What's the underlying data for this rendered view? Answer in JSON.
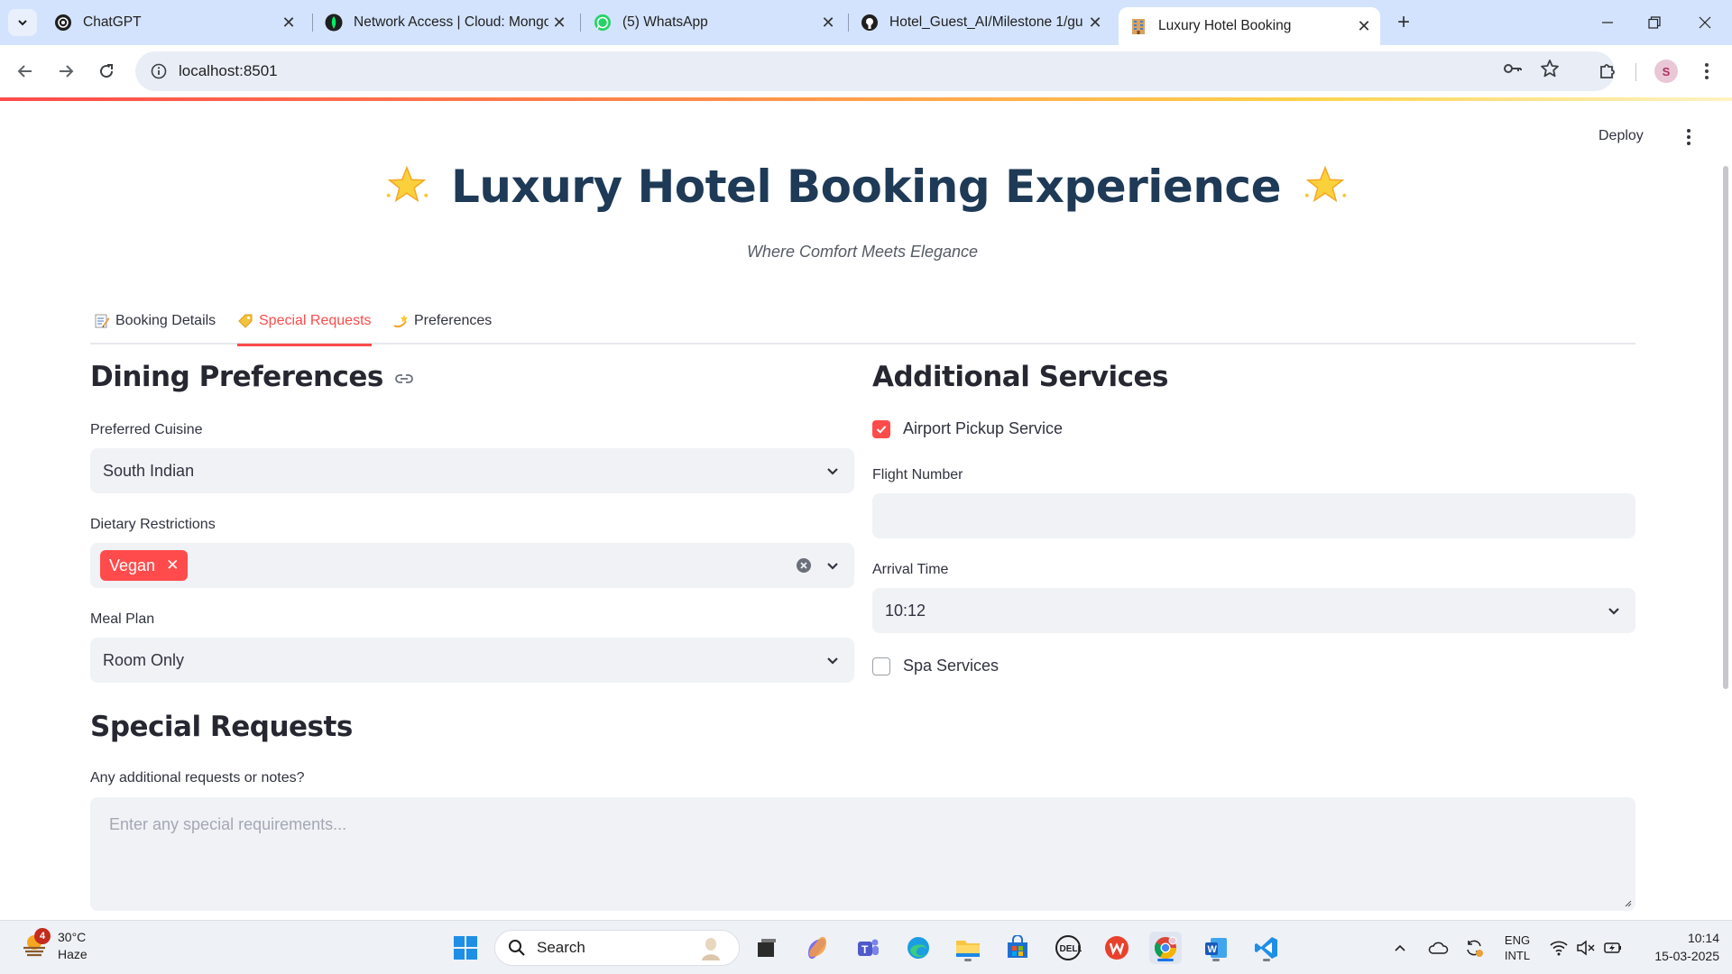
{
  "browser": {
    "tabs": [
      {
        "title": "ChatGPT",
        "icon": "chatgpt-icon",
        "active": false
      },
      {
        "title": "Network Access | Cloud: Mongo",
        "icon": "mongodb-leaf-icon",
        "active": false
      },
      {
        "title": "(5) WhatsApp",
        "icon": "whatsapp-icon",
        "active": false
      },
      {
        "title": "Hotel_Guest_AI/Milestone 1/gu",
        "icon": "github-icon",
        "active": false
      },
      {
        "title": "Luxury Hotel Booking",
        "icon": "hotel-building-icon",
        "active": true
      }
    ],
    "url": "localhost:8501"
  },
  "app": {
    "deploy_label": "Deploy",
    "title": "Luxury Hotel Booking Experience",
    "subtitle": "Where Comfort Meets Elegance",
    "tabs": [
      {
        "label": "Booking Details",
        "icon": "memo-icon",
        "active": false
      },
      {
        "label": "Special Requests",
        "icon": "label-tag-icon",
        "active": true
      },
      {
        "label": "Preferences",
        "icon": "dizzy-star-icon",
        "active": false
      }
    ],
    "dining": {
      "heading": "Dining Preferences",
      "cuisine_label": "Preferred Cuisine",
      "cuisine_value": "South Indian",
      "dietary_label": "Dietary Restrictions",
      "dietary_selected": [
        "Vegan"
      ],
      "meal_label": "Meal Plan",
      "meal_value": "Room Only"
    },
    "services": {
      "heading": "Additional Services",
      "airport_label": "Airport Pickup Service",
      "airport_checked": true,
      "flight_label": "Flight Number",
      "flight_value": "",
      "arrival_label": "Arrival Time",
      "arrival_value": "10:12",
      "spa_label": "Spa Services",
      "spa_checked": false
    },
    "special": {
      "heading": "Special Requests",
      "notes_label": "Any additional requests or notes?",
      "notes_placeholder": "Enter any special requirements..."
    }
  },
  "taskbar": {
    "weather_temp": "30°C",
    "weather_desc": "Haze",
    "weather_badge": "4",
    "search_label": "Search",
    "lang_top": "ENG",
    "lang_bottom": "INTL",
    "time": "10:14",
    "date": "15-03-2025"
  },
  "colors": {
    "accent": "#ff4b4b",
    "title": "#1e3a56",
    "input_bg": "#f0f2f6",
    "chrome_tabbar": "#d3e3fd"
  }
}
